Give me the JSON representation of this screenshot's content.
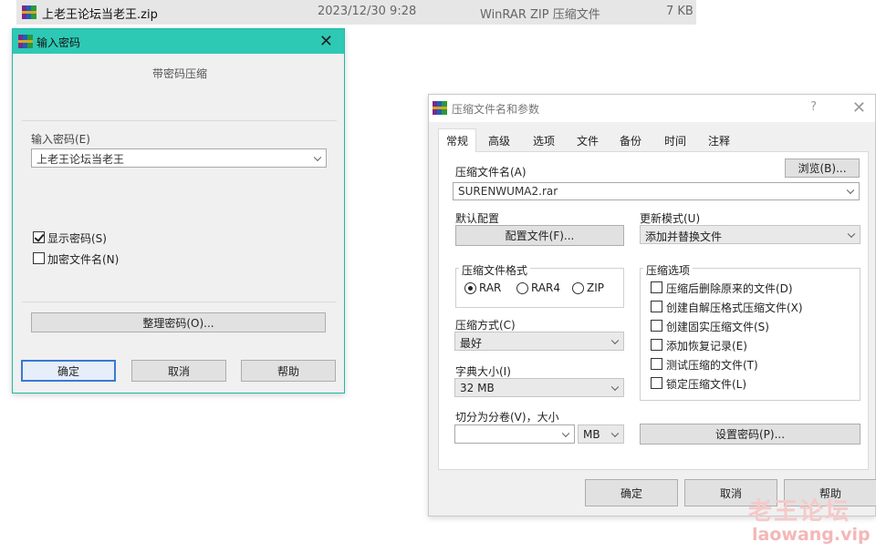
{
  "file_row": {
    "name": "上老王论坛当老王.zip",
    "date": "2023/12/30 9:28",
    "type": "WinRAR ZIP 压缩文件",
    "size": "7 KB"
  },
  "password_dialog": {
    "title": "输入密码",
    "subtitle": "带密码压缩",
    "password_label": "输入密码(E)",
    "password_value": "上老王论坛当老王",
    "show_password_label": "显示密码(S)",
    "show_password_checked": true,
    "encrypt_names_label": "加密文件名(N)",
    "encrypt_names_checked": false,
    "organize_button": "整理密码(O)...",
    "ok_button": "确定",
    "cancel_button": "取消",
    "help_button": "帮助"
  },
  "compress_dialog": {
    "title": "压缩文件名和参数",
    "help_glyph": "?",
    "tabs": [
      "常规",
      "高级",
      "选项",
      "文件",
      "备份",
      "时间",
      "注释"
    ],
    "active_tab": "常规",
    "archive_name_label": "压缩文件名(A)",
    "archive_name_value": "SURENWUMA2.rar",
    "browse_button": "浏览(B)...",
    "default_config_label": "默认配置",
    "profiles_button": "配置文件(F)...",
    "update_mode_label": "更新模式(U)",
    "update_mode_value": "添加并替换文件",
    "format_group_label": "压缩文件格式",
    "formats": [
      "RAR",
      "RAR4",
      "ZIP"
    ],
    "selected_format": "RAR",
    "options_group_label": "压缩选项",
    "options": [
      {
        "label": "压缩后删除原来的文件(D)",
        "checked": false
      },
      {
        "label": "创建自解压格式压缩文件(X)",
        "checked": false
      },
      {
        "label": "创建固实压缩文件(S)",
        "checked": false
      },
      {
        "label": "添加恢复记录(E)",
        "checked": false
      },
      {
        "label": "测试压缩的文件(T)",
        "checked": false
      },
      {
        "label": "锁定压缩文件(L)",
        "checked": false
      }
    ],
    "method_label": "压缩方式(C)",
    "method_value": "最好",
    "dict_label": "字典大小(I)",
    "dict_value": "32 MB",
    "split_label": "切分为分卷(V)，大小",
    "split_value": "",
    "split_unit": "MB",
    "set_password_button": "设置密码(P)...",
    "ok_button": "确定",
    "cancel_button": "取消",
    "help_button": "帮助"
  },
  "watermark": {
    "cn": "老王论坛",
    "url": "laowang.vip"
  },
  "colors": {
    "pw_titlebar": "#2ec9b5",
    "default_button_border": "#3a78d4",
    "watermark": "#f4b7b7"
  }
}
